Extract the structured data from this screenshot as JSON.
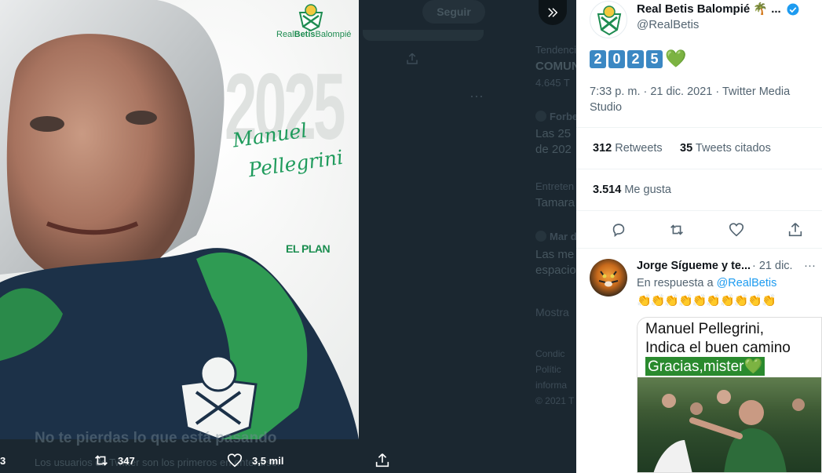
{
  "background": {
    "follow_label": "Seguir",
    "trending_items": [
      {
        "context": "Tendencia",
        "title": "COMUN",
        "count": "4.645 T"
      },
      {
        "context": "Forbe",
        "title": "Las 25 ",
        "sub": "de 202"
      },
      {
        "context": "Entreten",
        "title": "Tamara"
      },
      {
        "context": "Mar d",
        "title": "Las me",
        "sub": "espacio"
      }
    ],
    "show_more": "Mostra",
    "footer_lines": [
      "Condic",
      "Polític",
      "informa",
      "© 2021 T"
    ],
    "promo_title": "No te pierdas lo que está pasando",
    "promo_sub": "Los usuarios de Twitter son los primeros en enterarse."
  },
  "media": {
    "brand": {
      "prefix": "Real",
      "bold": "Betis",
      "suffix": "Balompié"
    },
    "year": "2025",
    "script_first": "Manuel",
    "script_last": "Pellegrini",
    "tagline": "EL PLAN"
  },
  "media_actions": {
    "partial_left": "3",
    "retweets": "347",
    "likes": "3,5 mil"
  },
  "tweet": {
    "author_name": "Real Betis Balompié 🌴 ...",
    "author_handle": "@RealBetis",
    "digits": [
      "2",
      "0",
      "2",
      "5"
    ],
    "heart": "💚",
    "meta": "7:33 p. m. · 21 dic. 2021 · Twitter Media Studio",
    "retweets_count": "312",
    "retweets_label": "Retweets",
    "quotes_count": "35",
    "quotes_label": "Tweets citados",
    "likes_count": "3.514",
    "likes_label": "Me gusta"
  },
  "reply": {
    "name": "Jorge Sígueme y te...",
    "time": "· 21 dic.",
    "replying_prefix": "En respuesta a ",
    "replying_handle": "@RealBetis",
    "claps": "👏👏👏👏👏👏👏👏👏👏",
    "image_line1": "Manuel Pellegrini,",
    "image_line2": "Indica el buen camino",
    "image_line3": "Gracias,mister💚"
  },
  "colors": {
    "accent_blue": "#1d9bf0",
    "betis_green": "#1a8d4f",
    "panel_bg": "#ffffff",
    "overlay_bg": "#1b2730"
  }
}
